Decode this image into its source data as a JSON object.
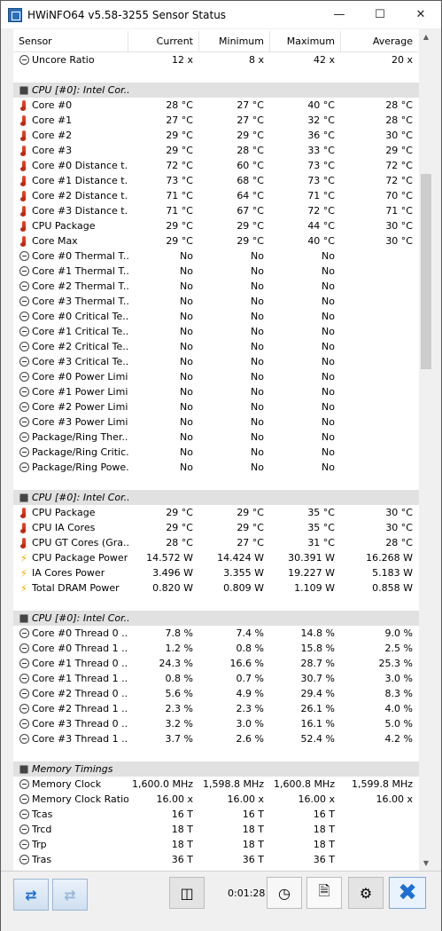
{
  "window": {
    "title": "HWiNFO64 v5.58-3255 Sensor Status"
  },
  "columns": [
    "Sensor",
    "Current",
    "Minimum",
    "Maximum",
    "Average"
  ],
  "rows": [
    {
      "t": "clock",
      "name": "Uncore Ratio",
      "v": [
        "12 x",
        "8 x",
        "42 x",
        "20 x"
      ]
    },
    {
      "t": "blank"
    },
    {
      "t": "group",
      "name": "CPU [#0]: Intel Cor..."
    },
    {
      "t": "therm",
      "name": "Core #0",
      "v": [
        "28 °C",
        "27 °C",
        "40 °C",
        "28 °C"
      ]
    },
    {
      "t": "therm",
      "name": "Core #1",
      "v": [
        "27 °C",
        "27 °C",
        "32 °C",
        "28 °C"
      ]
    },
    {
      "t": "therm",
      "name": "Core #2",
      "v": [
        "29 °C",
        "29 °C",
        "36 °C",
        "30 °C"
      ]
    },
    {
      "t": "therm",
      "name": "Core #3",
      "v": [
        "29 °C",
        "28 °C",
        "33 °C",
        "29 °C"
      ]
    },
    {
      "t": "therm",
      "name": "Core #0 Distance t...",
      "v": [
        "72 °C",
        "60 °C",
        "73 °C",
        "72 °C"
      ]
    },
    {
      "t": "therm",
      "name": "Core #1 Distance t...",
      "v": [
        "73 °C",
        "68 °C",
        "73 °C",
        "72 °C"
      ]
    },
    {
      "t": "therm",
      "name": "Core #2 Distance t...",
      "v": [
        "71 °C",
        "64 °C",
        "71 °C",
        "70 °C"
      ]
    },
    {
      "t": "therm",
      "name": "Core #3 Distance t...",
      "v": [
        "71 °C",
        "67 °C",
        "72 °C",
        "71 °C"
      ]
    },
    {
      "t": "therm",
      "name": "CPU Package",
      "v": [
        "29 °C",
        "29 °C",
        "44 °C",
        "30 °C"
      ]
    },
    {
      "t": "therm",
      "name": "Core Max",
      "v": [
        "29 °C",
        "29 °C",
        "40 °C",
        "30 °C"
      ]
    },
    {
      "t": "clock",
      "name": "Core #0 Thermal T...",
      "v": [
        "No",
        "No",
        "No",
        ""
      ]
    },
    {
      "t": "clock",
      "name": "Core #1 Thermal T...",
      "v": [
        "No",
        "No",
        "No",
        ""
      ]
    },
    {
      "t": "clock",
      "name": "Core #2 Thermal T...",
      "v": [
        "No",
        "No",
        "No",
        ""
      ]
    },
    {
      "t": "clock",
      "name": "Core #3 Thermal T...",
      "v": [
        "No",
        "No",
        "No",
        ""
      ]
    },
    {
      "t": "clock",
      "name": "Core #0 Critical Te...",
      "v": [
        "No",
        "No",
        "No",
        ""
      ]
    },
    {
      "t": "clock",
      "name": "Core #1 Critical Te...",
      "v": [
        "No",
        "No",
        "No",
        ""
      ]
    },
    {
      "t": "clock",
      "name": "Core #2 Critical Te...",
      "v": [
        "No",
        "No",
        "No",
        ""
      ]
    },
    {
      "t": "clock",
      "name": "Core #3 Critical Te...",
      "v": [
        "No",
        "No",
        "No",
        ""
      ]
    },
    {
      "t": "clock",
      "name": "Core #0 Power Limi...",
      "v": [
        "No",
        "No",
        "No",
        ""
      ]
    },
    {
      "t": "clock",
      "name": "Core #1 Power Limi...",
      "v": [
        "No",
        "No",
        "No",
        ""
      ]
    },
    {
      "t": "clock",
      "name": "Core #2 Power Limi...",
      "v": [
        "No",
        "No",
        "No",
        ""
      ]
    },
    {
      "t": "clock",
      "name": "Core #3 Power Limi...",
      "v": [
        "No",
        "No",
        "No",
        ""
      ]
    },
    {
      "t": "clock",
      "name": "Package/Ring Ther...",
      "v": [
        "No",
        "No",
        "No",
        ""
      ]
    },
    {
      "t": "clock",
      "name": "Package/Ring Critic...",
      "v": [
        "No",
        "No",
        "No",
        ""
      ]
    },
    {
      "t": "clock",
      "name": "Package/Ring Powe...",
      "v": [
        "No",
        "No",
        "No",
        ""
      ]
    },
    {
      "t": "blank"
    },
    {
      "t": "group",
      "name": "CPU [#0]: Intel Cor..."
    },
    {
      "t": "therm",
      "name": "CPU Package",
      "v": [
        "29 °C",
        "29 °C",
        "35 °C",
        "30 °C"
      ]
    },
    {
      "t": "therm",
      "name": "CPU IA Cores",
      "v": [
        "29 °C",
        "29 °C",
        "35 °C",
        "30 °C"
      ]
    },
    {
      "t": "therm",
      "name": "CPU GT Cores (Gra...",
      "v": [
        "28 °C",
        "27 °C",
        "31 °C",
        "28 °C"
      ]
    },
    {
      "t": "bolt",
      "name": "CPU Package Power",
      "v": [
        "14.572 W",
        "14.424 W",
        "30.391 W",
        "16.268 W"
      ]
    },
    {
      "t": "bolt",
      "name": "IA Cores Power",
      "v": [
        "3.496 W",
        "3.355 W",
        "19.227 W",
        "5.183 W"
      ]
    },
    {
      "t": "bolt",
      "name": "Total DRAM Power",
      "v": [
        "0.820 W",
        "0.809 W",
        "1.109 W",
        "0.858 W"
      ]
    },
    {
      "t": "blank"
    },
    {
      "t": "group",
      "name": "CPU [#0]: Intel Cor..."
    },
    {
      "t": "clock",
      "name": "Core #0 Thread 0 ...",
      "v": [
        "7.8 %",
        "7.4 %",
        "14.8 %",
        "9.0 %"
      ]
    },
    {
      "t": "clock",
      "name": "Core #0 Thread 1 ...",
      "v": [
        "1.2 %",
        "0.8 %",
        "15.8 %",
        "2.5 %"
      ]
    },
    {
      "t": "clock",
      "name": "Core #1 Thread 0 ...",
      "v": [
        "24.3 %",
        "16.6 %",
        "28.7 %",
        "25.3 %"
      ]
    },
    {
      "t": "clock",
      "name": "Core #1 Thread 1 ...",
      "v": [
        "0.8 %",
        "0.7 %",
        "30.7 %",
        "3.0 %"
      ]
    },
    {
      "t": "clock",
      "name": "Core #2 Thread 0 ...",
      "v": [
        "5.6 %",
        "4.9 %",
        "29.4 %",
        "8.3 %"
      ]
    },
    {
      "t": "clock",
      "name": "Core #2 Thread 1 ...",
      "v": [
        "2.3 %",
        "2.3 %",
        "26.1 %",
        "4.0 %"
      ]
    },
    {
      "t": "clock",
      "name": "Core #3 Thread 0 ...",
      "v": [
        "3.2 %",
        "3.0 %",
        "16.1 %",
        "5.0 %"
      ]
    },
    {
      "t": "clock",
      "name": "Core #3 Thread 1 ...",
      "v": [
        "3.7 %",
        "2.6 %",
        "52.4 %",
        "4.2 %"
      ]
    },
    {
      "t": "blank"
    },
    {
      "t": "group",
      "name": "Memory Timings"
    },
    {
      "t": "clock",
      "name": "Memory Clock",
      "v": [
        "1,600.0 MHz",
        "1,598.8 MHz",
        "1,600.8 MHz",
        "1,599.8 MHz"
      ]
    },
    {
      "t": "clock",
      "name": "Memory Clock Ratio",
      "v": [
        "16.00 x",
        "16.00 x",
        "16.00 x",
        "16.00 x"
      ]
    },
    {
      "t": "clock",
      "name": "Tcas",
      "v": [
        "16 T",
        "16 T",
        "16 T",
        ""
      ]
    },
    {
      "t": "clock",
      "name": "Trcd",
      "v": [
        "18 T",
        "18 T",
        "18 T",
        ""
      ]
    },
    {
      "t": "clock",
      "name": "Trp",
      "v": [
        "18 T",
        "18 T",
        "18 T",
        ""
      ]
    },
    {
      "t": "clock",
      "name": "Tras",
      "v": [
        "36 T",
        "36 T",
        "36 T",
        ""
      ]
    }
  ],
  "toolbar": {
    "timer": "0:01:28"
  },
  "icons": {
    "back": "arrow-left-right-icon",
    "fwd": "arrow-left-right-disabled-icon",
    "network": "network-icon",
    "clock": "clock-icon",
    "report": "report-add-icon",
    "settings": "gear-icon",
    "close": "close-icon"
  }
}
